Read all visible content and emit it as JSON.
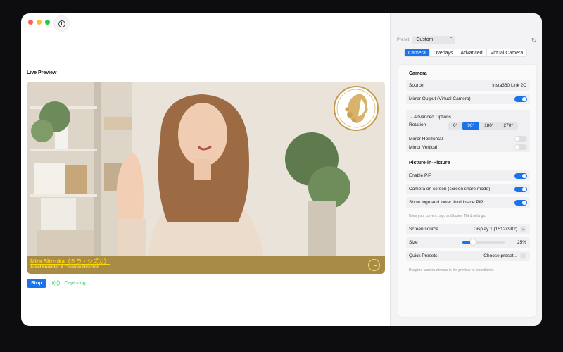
{
  "live_preview": {
    "label": "Live Preview",
    "name_line": "Mira Shizuka（ミラ・シズカ）",
    "title_line": "Aurel Founder & Creative Director",
    "stop_label": "Stop",
    "status_label": "Capturing"
  },
  "settings": {
    "preset_label": "Preset",
    "preset_value": "Custom",
    "tabs": [
      "Camera",
      "Overlays",
      "Advanced",
      "Virtual Camera"
    ],
    "active_tab": "Camera",
    "camera": {
      "section_title": "Camera",
      "source_label": "Source",
      "source_value": "Insta360 Link 2C",
      "mirror_output_label": "Mirror Output (Virtual Camera)",
      "mirror_output_on": true,
      "advanced_label": "Advanced Options",
      "rotation_label": "Rotation",
      "rotation_options": [
        "0°",
        "90°",
        "180°",
        "270°"
      ],
      "rotation_selected": "90°",
      "mirror_horizontal_label": "Mirror Horizontal",
      "mirror_horizontal_on": false,
      "mirror_vertical_label": "Mirror Vertical",
      "mirror_vertical_on": false
    },
    "pip": {
      "section_title": "Picture-in-Picture",
      "enable_label": "Enable PiP",
      "enable_on": true,
      "camera_on_screen_label": "Camera on screen (screen share mode)",
      "camera_on_screen_on": true,
      "show_logo_label": "Show logo and lower third inside PiP",
      "show_logo_on": true,
      "logo_note": "Uses your current Logo and Lower Third settings.",
      "screen_source_label": "Screen source",
      "screen_source_value": "Display 1 (1512×982)",
      "size_label": "Size",
      "size_value": "25%",
      "size_fraction": 0.25,
      "quick_presets_label": "Quick Presets",
      "quick_presets_value": "Choose preset...",
      "drag_note": "Drag the camera window in the preview to reposition it."
    }
  },
  "colors": {
    "accent": "#1a73e8",
    "lower_third_bg": "#a88b47",
    "lower_third_text": "#ffd800",
    "capturing": "#34c759"
  }
}
